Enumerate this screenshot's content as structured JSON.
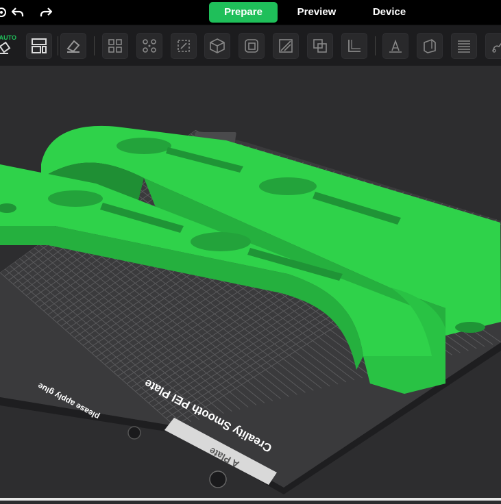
{
  "topbar": {
    "tabs": [
      {
        "label": "Prepare",
        "active": true
      },
      {
        "label": "Preview",
        "active": false
      },
      {
        "label": "Device",
        "active": false
      }
    ],
    "icons": [
      "settings-icon",
      "undo-icon",
      "redo-icon"
    ]
  },
  "toolbar": {
    "auto_label": "AUTO",
    "tools": [
      "auto-orient",
      "arrange",
      "erase",
      "layout-grid",
      "distribute",
      "scale",
      "cube-view",
      "cut",
      "slash",
      "boolean",
      "measure",
      "support-paint",
      "seam-paint",
      "layer-list",
      "brush"
    ]
  },
  "plate": {
    "brand_text": "Creality Smooth PEI Plate",
    "hint_text": "please apply glue",
    "side_label": "A Plate"
  },
  "colors": {
    "accent": "#1fbf5a",
    "model": "#2fd24a",
    "bed": "#3a3a3c",
    "grid": "#5a5a5c"
  }
}
